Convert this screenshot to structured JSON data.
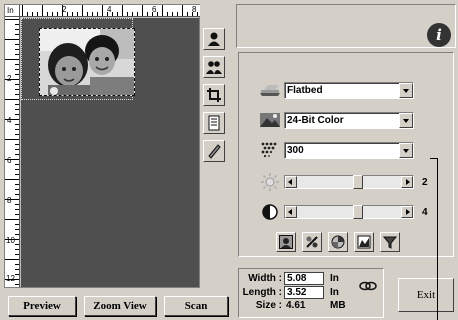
{
  "preview": {
    "corner_label": "In",
    "ruler_top_labels": [
      "2",
      "4",
      "6",
      "8"
    ],
    "ruler_left_labels": [
      "2",
      "4",
      "6",
      "8",
      "10",
      "12"
    ]
  },
  "toolbar": {
    "icons": [
      "single-person-icon",
      "two-persons-icon",
      "crop-icon",
      "document-icon",
      "pen-icon"
    ]
  },
  "settings": {
    "scan_source": "Flatbed",
    "image_type": "24-Bit Color",
    "resolution": "300",
    "brightness_value": "2",
    "contrast_value": "4",
    "brightness_level_fraction": 0.6,
    "contrast_level_fraction": 0.6
  },
  "size_info": {
    "width_label": "Width :",
    "width_value": "5.08",
    "width_unit": "In",
    "length_label": "Length :",
    "length_value": "3.52",
    "length_unit": "In",
    "size_label": "Size :",
    "size_value": "4.61",
    "size_unit": "MB"
  },
  "buttons": {
    "preview": "Preview",
    "zoom_view": "Zoom View",
    "scan": "Scan",
    "exit": "Exit",
    "info": "i"
  }
}
